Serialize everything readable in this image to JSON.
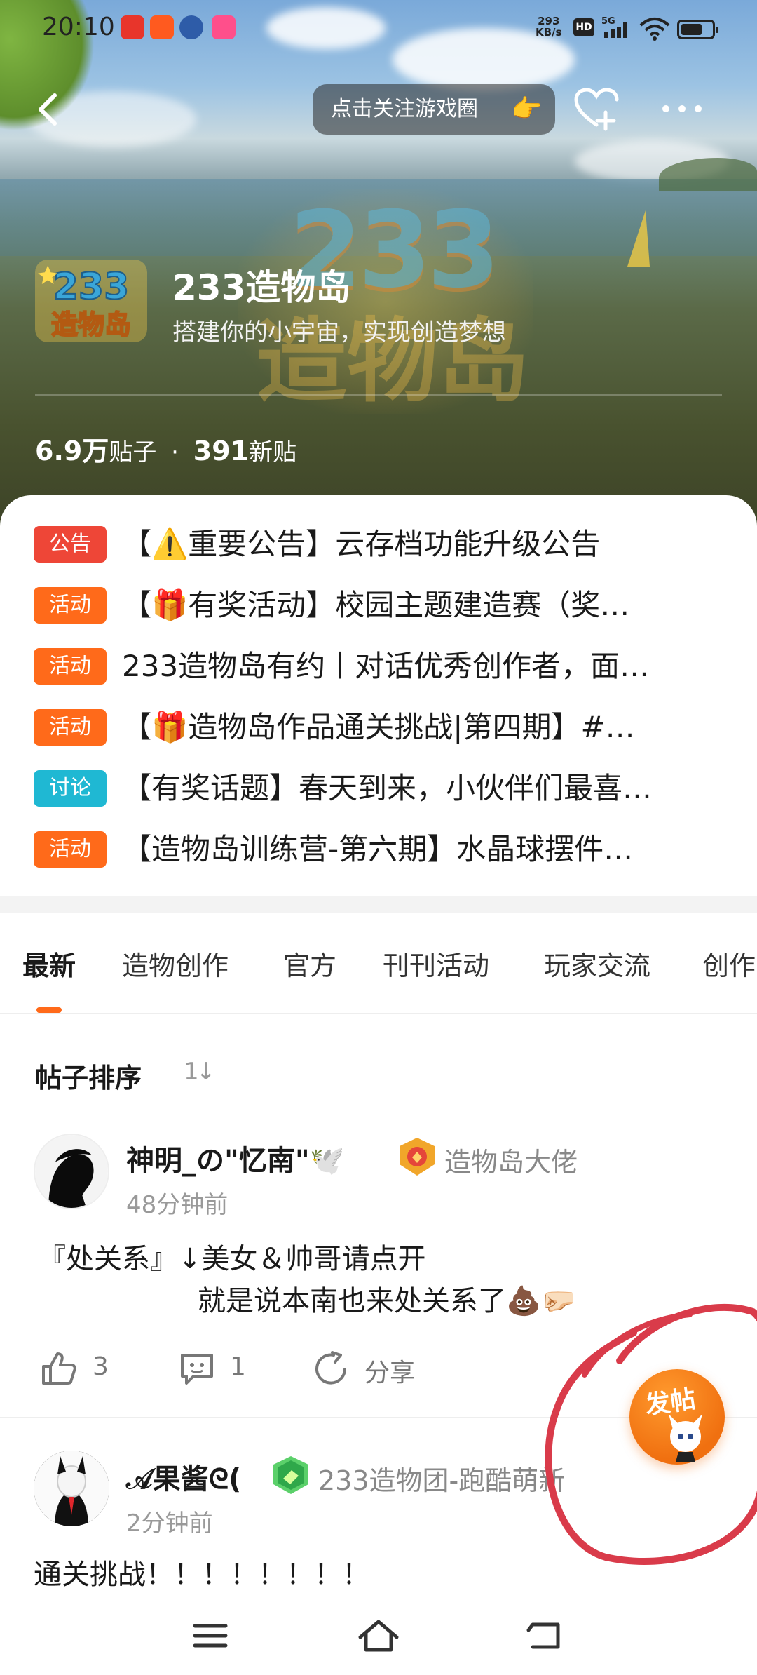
{
  "status_bar": {
    "time": "20:10",
    "net_speed": "293",
    "net_unit": "KB/s",
    "hd": "HD",
    "network": "5G"
  },
  "header": {
    "follow_label": "点击关注游戏圈",
    "follow_emoji": "👉"
  },
  "game": {
    "logo_top": "233",
    "logo_bottom": "造物岛",
    "title": "233造物岛",
    "subtitle": "搭建你的小宇宙，实现创造梦想",
    "posts_count": "6.9万",
    "posts_label": "贴子",
    "separator": "·",
    "new_count": "391",
    "new_label": "新贴"
  },
  "announcements": [
    {
      "tag": "公告",
      "color": "#ee4637",
      "title": "【⚠️重要公告】云存档功能升级公告"
    },
    {
      "tag": "活动",
      "color": "#ff6a1a",
      "title": "【🎁有奖活动】校园主题建造赛（奖…"
    },
    {
      "tag": "活动",
      "color": "#ff6a1a",
      "title": "233造物岛有约丨对话优秀创作者，面…"
    },
    {
      "tag": "活动",
      "color": "#ff6a1a",
      "title": "【🎁造物岛作品通关挑战|第四期】#…"
    },
    {
      "tag": "讨论",
      "color": "#1fb8d3",
      "title": "【有奖话题】春天到来，小伙伴们最喜…"
    },
    {
      "tag": "活动",
      "color": "#ff6a1a",
      "title": "【造物岛训练营-第六期】水晶球摆件…"
    }
  ],
  "tabs": [
    "最新",
    "造物创作",
    "官方",
    "刊刊活动",
    "玩家交流",
    "创作"
  ],
  "sort": {
    "label": "帖子排序",
    "icon": "1↓"
  },
  "posts": [
    {
      "username": "神明_の\"忆南\"🕊️",
      "badge": "造物岛大佬",
      "time": "48分钟前",
      "line1": "『处关系』↓美女＆帅哥请点开",
      "line2": "就是说本南也来处关系了💩🤛🏻",
      "likes": "3",
      "comments": "1",
      "share": "分享"
    },
    {
      "username": "𝒜果酱ᘓ(",
      "badge": "233造物团-跑酷萌新",
      "time": "2分钟前",
      "line1": "通关挑战！！！！！！！！"
    }
  ],
  "fab": {
    "label": "发帖"
  },
  "colors": {
    "accent": "#ff6a1a",
    "announce": "#ee4637",
    "discuss": "#1fb8d3"
  }
}
